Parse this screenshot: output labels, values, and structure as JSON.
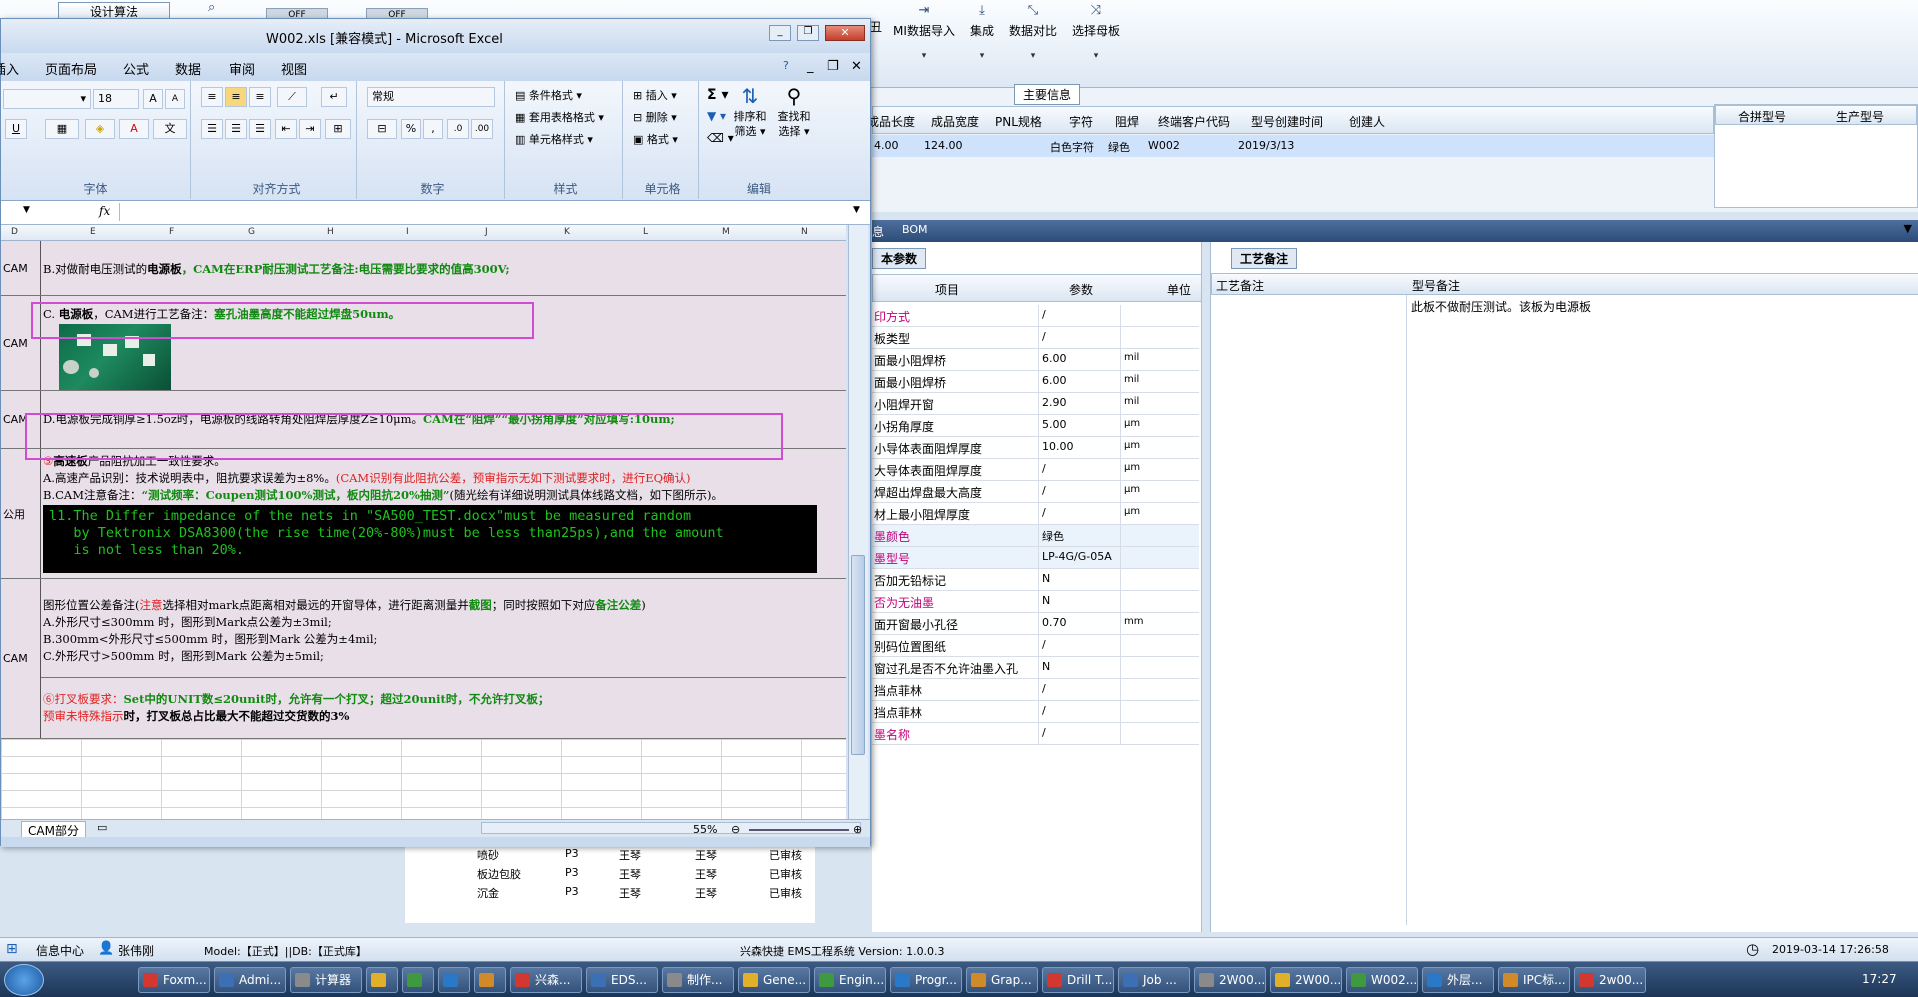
{
  "app_toolbar": {
    "left_btn": "设计算法",
    "toggle_off_1": "OFF",
    "toggle_off_2": "OFF",
    "right_buttons": [
      "MI数据导入",
      "集成",
      "数据对比",
      "选择母板"
    ],
    "left_frag": "丑"
  },
  "main_info": {
    "title": "主要信息",
    "columns": [
      "成品长度",
      "成品宽度",
      "PNL规格",
      "字符",
      "阻焊",
      "终端客户代码",
      "型号创建时间",
      "创建人"
    ],
    "row": {
      "length": "4.00",
      "width": "124.00",
      "pnl": "",
      "char": "白色字符",
      "solder": "绿色",
      "customer": "W002",
      "created": "2019/3/13",
      "creator": ""
    },
    "right_columns": [
      "合拼型号",
      "生产型号"
    ]
  },
  "lower_tabs": {
    "left": "息",
    "bom": "BOM"
  },
  "basic_params": {
    "title": "本参数",
    "headers": {
      "item": "项目",
      "param": "参数",
      "unit": "单位"
    },
    "rows": [
      {
        "item": "印方式",
        "param": "/",
        "unit": "",
        "red": true
      },
      {
        "item": "板类型",
        "param": "/",
        "unit": "",
        "red": false
      },
      {
        "item": "面最小阻焊桥",
        "param": "6.00",
        "unit": "mil",
        "red": false
      },
      {
        "item": "面最小阻焊桥",
        "param": "6.00",
        "unit": "mil",
        "red": false
      },
      {
        "item": "小阻焊开窗",
        "param": "2.90",
        "unit": "mil",
        "red": false
      },
      {
        "item": "小拐角厚度",
        "param": "5.00",
        "unit": "μm",
        "red": false
      },
      {
        "item": "小导体表面阻焊厚度",
        "param": "10.00",
        "unit": "μm",
        "red": false
      },
      {
        "item": "大导体表面阻焊厚度",
        "param": "/",
        "unit": "μm",
        "red": false
      },
      {
        "item": "焊超出焊盘最大高度",
        "param": "/",
        "unit": "μm",
        "red": false
      },
      {
        "item": "材上最小阻焊厚度",
        "param": "/",
        "unit": "μm",
        "red": false
      },
      {
        "item": "墨颜色",
        "param": "绿色",
        "unit": "",
        "red": true
      },
      {
        "item": "墨型号",
        "param": "LP-4G/G-05A",
        "unit": "",
        "red": true
      },
      {
        "item": "否加无铅标记",
        "param": "N",
        "unit": "",
        "red": false
      },
      {
        "item": "否为无油墨",
        "param": "N",
        "unit": "",
        "red": true
      },
      {
        "item": "面开窗最小孔径",
        "param": "0.70",
        "unit": "mm",
        "red": false
      },
      {
        "item": "别码位置图纸",
        "param": "/",
        "unit": "",
        "red": false
      },
      {
        "item": "窗过孔是否不允许油墨入孔",
        "param": "N",
        "unit": "",
        "red": false
      },
      {
        "item": "挡点菲林",
        "param": "/",
        "unit": "",
        "red": false
      },
      {
        "item": "挡点菲林",
        "param": "/",
        "unit": "",
        "red": false
      },
      {
        "item": "墨名称",
        "param": "/",
        "unit": "",
        "red": true
      }
    ]
  },
  "process_notes": {
    "tab": "工艺备注",
    "col1": "工艺备注",
    "col2": "型号备注",
    "note": "此板不做耐压测试。该板为电源板"
  },
  "bottom_grid": {
    "rows": [
      {
        "name": "喷砂",
        "c1": "P3",
        "c2": "王琴",
        "c3": "王琴",
        "c4": "已审核"
      },
      {
        "name": "板边包胶",
        "c1": "P3",
        "c2": "王琴",
        "c3": "王琴",
        "c4": "已审核"
      },
      {
        "name": "沉金",
        "c1": "P3",
        "c2": "王琴",
        "c3": "王琴",
        "c4": "已审核"
      }
    ]
  },
  "excel": {
    "title": "W002.xls [兼容模式] - Microsoft Excel",
    "menu": [
      "插入",
      "页面布局",
      "公式",
      "数据",
      "审阅",
      "视图"
    ],
    "font_size": "18",
    "number_format": "常规",
    "ribbon": {
      "font_group": "字体",
      "align_group": "对齐方式",
      "number_group": "数字",
      "style_group": "样式",
      "cell_group": "单元格",
      "edit_group": "编辑",
      "cond_format": "条件格式",
      "table_format": "套用表格格式",
      "cell_style": "单元格样式",
      "insert": "插入",
      "delete": "删除",
      "format": "格式",
      "sort": "排序和筛选",
      "find": "查找和选择",
      "sort_l1": "排序和",
      "sort_l2": "筛选",
      "find_l1": "查找和",
      "find_l2": "选择"
    },
    "fx": "fx",
    "col_headers": [
      "D",
      "E",
      "F",
      "G",
      "H",
      "I",
      "J",
      "K",
      "L",
      "M",
      "N"
    ],
    "rows": {
      "r1_label": "CAM",
      "r1_a": "B.对做耐电压测试的",
      "r1_b": "电源板",
      "r1_c": "，CAM在ERP耐压测试工艺备注:电压需要比要求的值高300V;",
      "r2_label": "CAM",
      "r2_a": "C.",
      "r2_b": "电源板",
      "r2_c": "，CAM进行工艺备注：",
      "r2_d": "塞孔油墨高度不能超过焊盘50um。",
      "r3_label": "CAM",
      "r3_a": "D.电源板完成铜厚≥1.5oz时，电源板的线路转角处阻焊层厚度Z≥10μm。",
      "r3_b": "CAM在“阻焊”“最小拐角厚度”对应填写:10um;",
      "r4_label": "公用",
      "r4_a": "⑤",
      "r4_b": "高速板",
      "r4_c": "产品阻抗加工一致性要求。",
      "r4_d": "A.高速产品识别：技术说明表中，阻抗要求误差为±8%。",
      "r4_e": "(CAM识别有此阻抗公差，预审指示无如下测试要求时，进行EQ确认)",
      "r4_f": "B.CAM注意备注：",
      "r4_g": "“测试频率：Coupen测试100%测试，板内阻抗20%抽测”",
      "r4_h": "(随光绘有详细说明测试具体线路文档，如下图所示)。",
      "r4_code1": "l1.The Differ impedance of the nets in \"SA500_TEST.docx\"must be measured random",
      "r4_code2": "   by Tektronix DSA8300(the rise time(20%-80%)must be less than25ps),and the amount",
      "r4_code3": "   is not less than 20%.",
      "r5_label": "CAM",
      "r5_a": "图形位置公差备注(",
      "r5_b": "注意",
      "r5_c": "选择相对mark点距离相对最远的开窗导体，进行距离测量并",
      "r5_d": "截图",
      "r5_e": "；同时按照如下对应",
      "r5_f": "备注公差",
      "r5_g": ")",
      "r5_h": "A.外形尺寸≤300mm 时，图形到Mark点公差为±3mil;",
      "r5_i": "B.300mm<外形尺寸≤500mm 时，图形到Mark 公差为±4mil;",
      "r5_j": "C.外形尺寸>500mm 时，图形到Mark 公差为±5mil;",
      "r5_k": "⑥打叉板要求：",
      "r5_l": "Set中的UNIT数≤20unit时，允许有一个打叉；超过20unit时，不允许打叉板；",
      "r5_m": "预审未特殊指示",
      "r5_n": "时，打叉板总占比最大不能超过交货数的3%"
    },
    "sheet_tab": "CAM部分",
    "zoom": "55%"
  },
  "statusbar": {
    "info_center": "信息中心",
    "user": "张伟刚",
    "model": "Model:【正式】||DB:【正式库】",
    "system": "兴森快捷 EMS工程系统 Version: 1.0.0.3",
    "datetime": "2019-03-14 17:26:58"
  },
  "taskbar": {
    "items": [
      "Foxm...",
      "Admi...",
      "计算器",
      "",
      "",
      "",
      "",
      "兴森...",
      "EDS...",
      "制作...",
      "Gene...",
      "Engin...",
      "Progr...",
      "Grap...",
      "Drill T...",
      "Job ...",
      "2W00...",
      "2W00...",
      "W002...",
      "外层...",
      "IPC标...",
      "2w00..."
    ],
    "time": "17:27"
  },
  "colors": {
    "accent": "#2b4b74",
    "highlight_box": "#d24bd4",
    "note_green": "#118a11",
    "note_red": "#e02020"
  }
}
